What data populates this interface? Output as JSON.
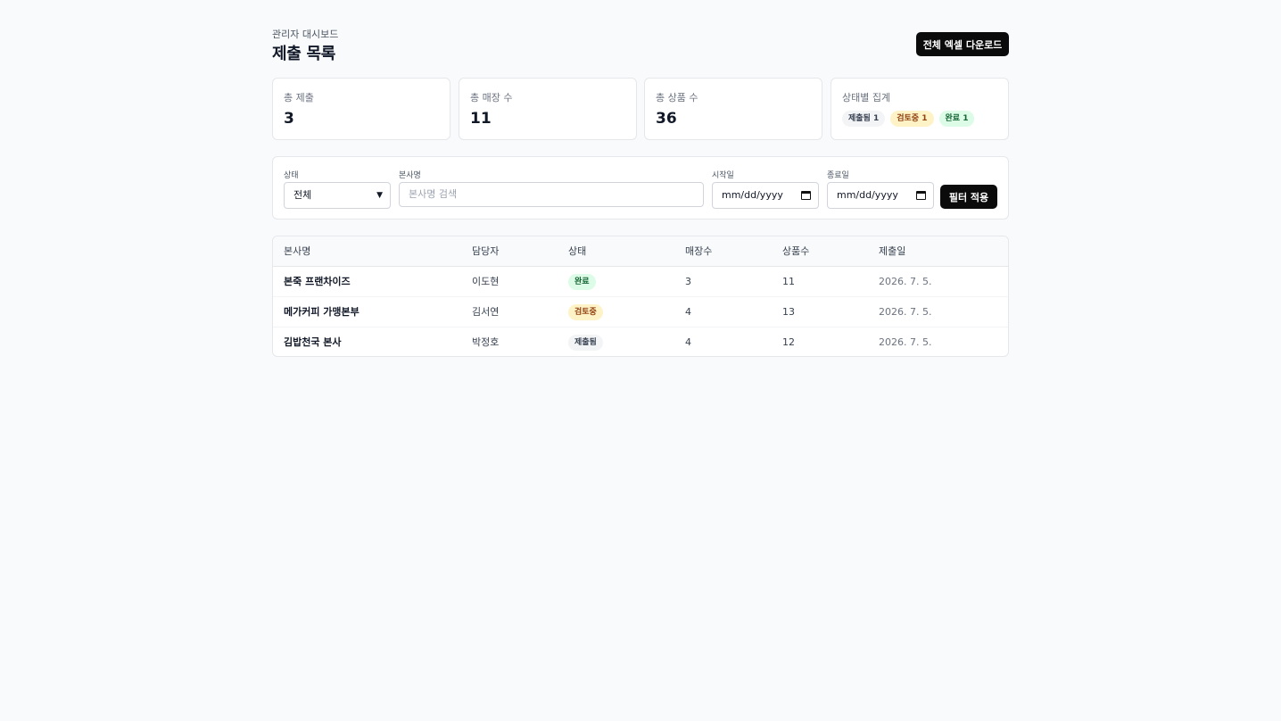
{
  "header": {
    "breadcrumb": "관리자 대시보드",
    "title": "제출 목록",
    "export_label": "전체 엑셀 다운로드"
  },
  "stats": {
    "total_submissions": {
      "label": "총 제출",
      "value": "3"
    },
    "total_stores": {
      "label": "총 매장 수",
      "value": "11"
    },
    "total_products": {
      "label": "총 상품 수",
      "value": "36"
    },
    "status_summary": {
      "label": "상태별 집계",
      "chips": [
        "제출됨 1",
        "검토중 1",
        "완료 1"
      ]
    }
  },
  "filters": {
    "status": {
      "label": "상태",
      "value": "전체"
    },
    "company": {
      "label": "본사명",
      "placeholder": "본사명 검색"
    },
    "start_date": {
      "label": "시작일",
      "value": "mm/dd/yyyy"
    },
    "end_date": {
      "label": "종료일",
      "value": "mm/dd/yyyy"
    },
    "apply_label": "필터 적용"
  },
  "table": {
    "headers": [
      "본사명",
      "담당자",
      "상태",
      "매장수",
      "상품수",
      "제출일"
    ],
    "rows": [
      {
        "name": "본죽 프랜차이즈",
        "manager": "이도현",
        "status": "완료",
        "stores": "3",
        "products": "11",
        "date": "2026. 7. 5."
      },
      {
        "name": "메가커피 가맹본부",
        "manager": "김서연",
        "status": "검토중",
        "stores": "4",
        "products": "13",
        "date": "2026. 7. 5."
      },
      {
        "name": "김밥천국 본사",
        "manager": "박정호",
        "status": "제출됨",
        "stores": "4",
        "products": "12",
        "date": "2026. 7. 5."
      }
    ]
  },
  "colors": {
    "primary_button": "#0b0b0b",
    "status_submitted": "#f3f4f6",
    "status_review": "#fef3c7",
    "status_done": "#dcfce7"
  },
  "icons": {
    "select_arrow": "chevron-down-icon",
    "date_picker": "calendar-icon"
  }
}
